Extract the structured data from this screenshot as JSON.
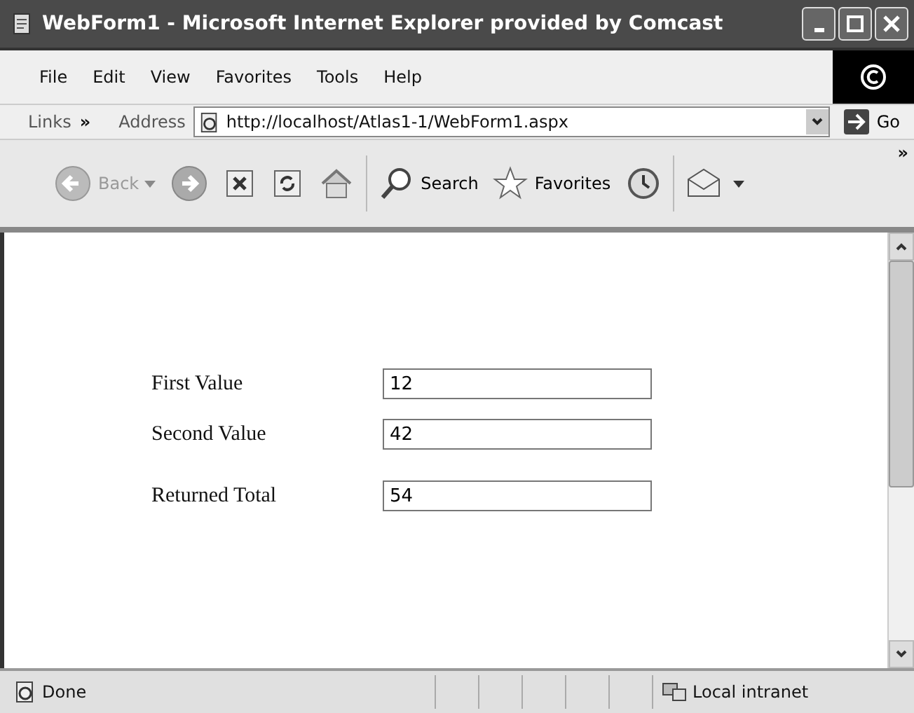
{
  "window": {
    "title": "WebForm1 - Microsoft Internet Explorer provided by Comcast"
  },
  "menu": [
    "File",
    "Edit",
    "View",
    "Favorites",
    "Tools",
    "Help"
  ],
  "address_bar": {
    "links_label": "Links",
    "links_chevron": "»",
    "label": "Address",
    "url": "http://localhost/Atlas1-1/WebForm1.aspx",
    "go": "Go"
  },
  "toolbar": {
    "back": {
      "label": "Back",
      "disabled": true
    },
    "search": "Search",
    "favorites": "Favorites",
    "chevron": "»"
  },
  "form": [
    {
      "label": "First Value",
      "value": "12"
    },
    {
      "label": "Second Value",
      "value": "42"
    },
    {
      "label": "Returned Total",
      "value": "54"
    }
  ],
  "status_bar": {
    "text": "Done",
    "zone": "Local intranet"
  }
}
